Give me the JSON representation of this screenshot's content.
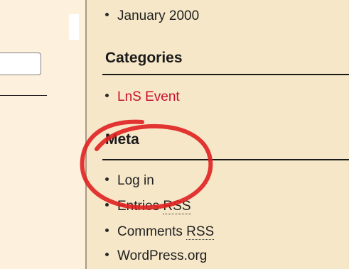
{
  "archives": {
    "items": [
      {
        "label": "January 2000"
      }
    ]
  },
  "categories": {
    "title": "Categories",
    "items": [
      {
        "label": "LnS Event"
      }
    ]
  },
  "meta": {
    "title": "Meta",
    "items": [
      {
        "label": "Log in"
      },
      {
        "label_prefix": "Entries ",
        "label_abbr": "RSS"
      },
      {
        "label_prefix": "Comments ",
        "label_abbr": "RSS"
      },
      {
        "label": "WordPress.org"
      }
    ]
  },
  "colors": {
    "background": "#f6e7c8",
    "left_column": "#fdf0dc",
    "category_link": "#c8102e",
    "annotation_circle": "#e02020"
  },
  "icons": {
    "bubble": "speech-bubble-icon",
    "annotation": "red-circle-annotation"
  }
}
